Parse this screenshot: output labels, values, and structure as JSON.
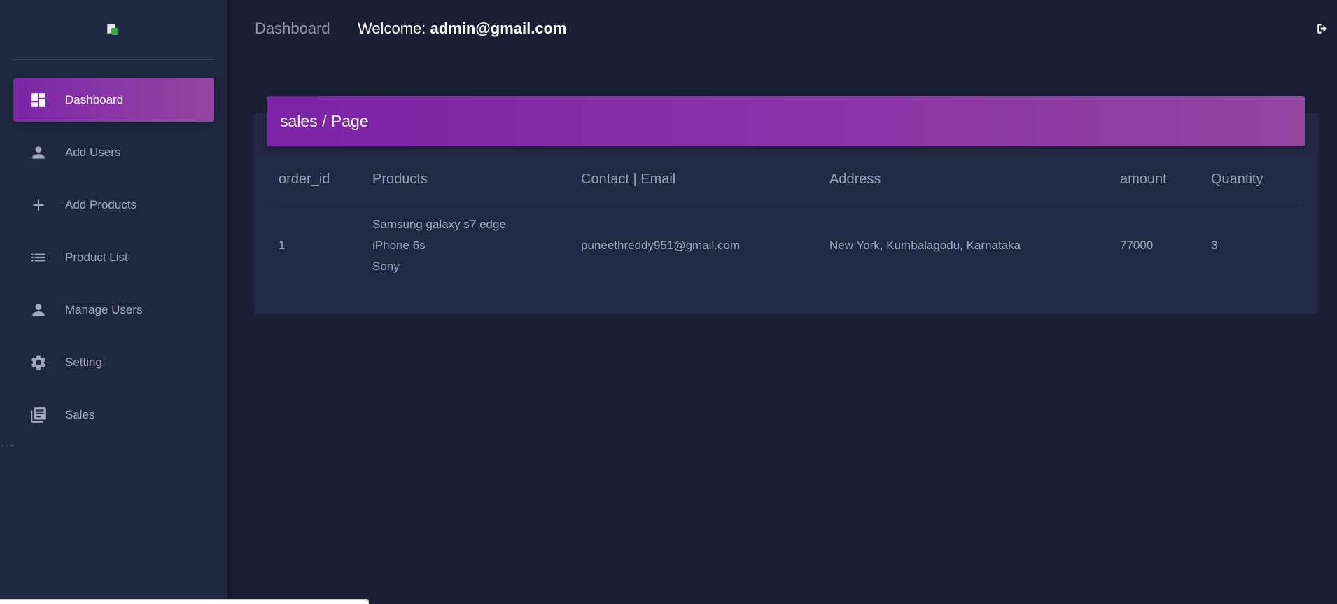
{
  "sidebar": {
    "logo_alt": "logo",
    "items": [
      {
        "label": "Dashboard",
        "icon": "dashboard-icon",
        "active": true
      },
      {
        "label": "Add Users",
        "icon": "person-icon"
      },
      {
        "label": "Add Products",
        "icon": "plus-icon"
      },
      {
        "label": "Product List",
        "icon": "list-icon"
      },
      {
        "label": "Manage Users",
        "icon": "person-icon"
      },
      {
        "label": "Setting",
        "icon": "gear-icon"
      },
      {
        "label": "Sales",
        "icon": "library-books-icon"
      }
    ],
    "stray_text": "-->"
  },
  "topbar": {
    "title": "Dashboard",
    "welcome_prefix": "Welcome: ",
    "welcome_user": "admin@gmail.com",
    "logout_icon": "logout-icon"
  },
  "card": {
    "header": "sales / Page",
    "columns": [
      "order_id",
      "Products",
      "Contact | Email",
      "Address",
      "amount",
      "Quantity"
    ],
    "rows": [
      {
        "order_id": "1",
        "products": [
          "Samsung galaxy s7 edge",
          "iPhone 6s",
          "Sony"
        ],
        "email": "puneethreddy951@gmail.com",
        "address": "New York, Kumbalagodu, Karnataka",
        "amount": "77000",
        "quantity": "3"
      }
    ]
  },
  "colors": {
    "background": "#1b1f35",
    "sidebar": "#202741",
    "card": "#222944",
    "accent": "#8a36a6"
  }
}
